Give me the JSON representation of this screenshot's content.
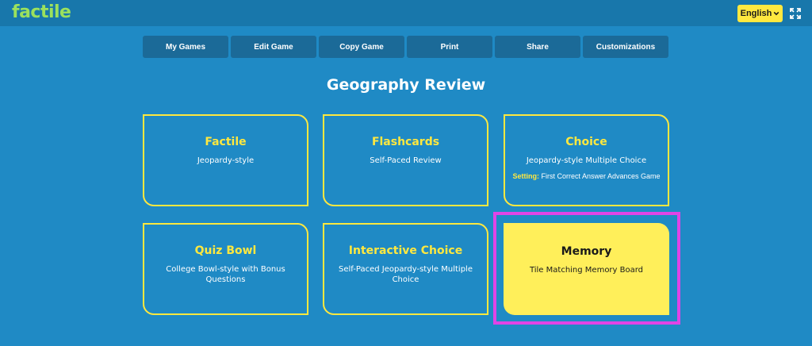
{
  "brand": {
    "logo": "factile",
    "logo_color": "#9be15d"
  },
  "header": {
    "language": "English",
    "icons": [
      "chevron-down-icon",
      "fullscreen-icon"
    ]
  },
  "tabs": [
    {
      "label": "My Games"
    },
    {
      "label": "Edit Game"
    },
    {
      "label": "Copy Game"
    },
    {
      "label": "Print"
    },
    {
      "label": "Share"
    },
    {
      "label": "Customizations"
    }
  ],
  "page": {
    "title": "Geography Review"
  },
  "modes": [
    {
      "name": "Factile",
      "description": "Jeopardy-style"
    },
    {
      "name": "Flashcards",
      "description": "Self-Paced Review"
    },
    {
      "name": "Choice",
      "description": "Jeopardy-style Multiple Choice",
      "setting_label": "Setting:",
      "setting_value": "First Correct Answer Advances Game"
    },
    {
      "name": "Quiz Bowl",
      "description": "College Bowl-style with Bonus Questions"
    },
    {
      "name": "Interactive Choice",
      "description": "Self-Paced Jeopardy-style Multiple Choice"
    },
    {
      "name": "Memory",
      "description": "Tile Matching Memory Board",
      "selected": true
    }
  ],
  "colors": {
    "background": "#1f8ac5",
    "accent_yellow": "#ffe83f",
    "tab_bg": "#1b6a98",
    "highlight": "#e044e6"
  }
}
